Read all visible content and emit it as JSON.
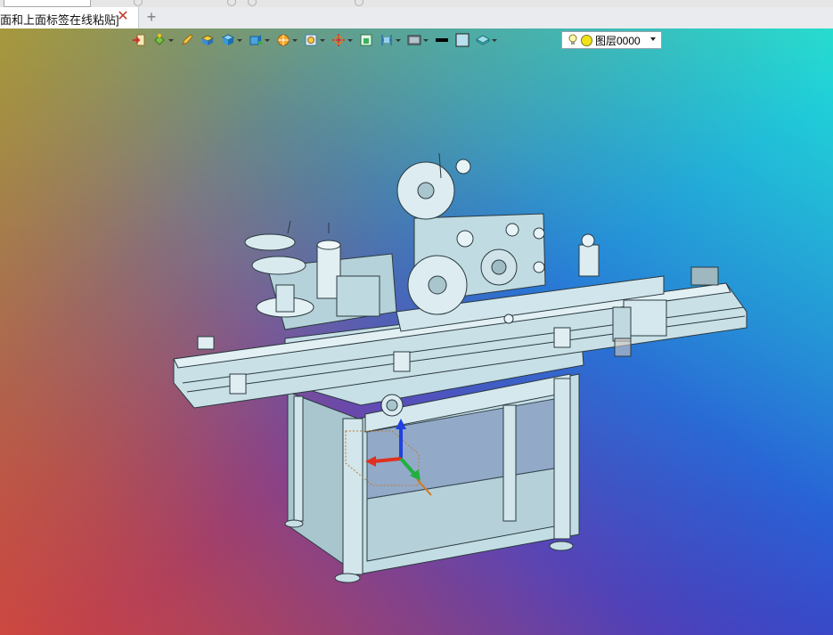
{
  "tabs": [
    {
      "label": "面和上面标签在线粘贴]",
      "close_glyph": "✕"
    }
  ],
  "new_tab_glyph": "+",
  "toolbar": {
    "buttons": [
      {
        "icon": "exit-sketch-icon",
        "dropdown": false
      },
      {
        "icon": "paint-bucket-icon",
        "dropdown": true
      },
      {
        "icon": "pencil-icon",
        "dropdown": false
      },
      {
        "icon": "box-face-icon",
        "dropdown": false
      },
      {
        "icon": "solid-cube-icon",
        "dropdown": true
      },
      {
        "icon": "view-cube-icon",
        "dropdown": true
      },
      {
        "icon": "render-sphere-icon",
        "dropdown": true
      },
      {
        "icon": "zoom-frame-icon",
        "dropdown": true
      },
      {
        "icon": "orbit-axes-icon",
        "dropdown": true
      },
      {
        "icon": "section-view-icon",
        "dropdown": false
      },
      {
        "icon": "measure-icon",
        "dropdown": true
      },
      {
        "icon": "display-mode-icon",
        "dropdown": true
      },
      {
        "icon": "line-style-icon",
        "dropdown": false
      },
      {
        "icon": "fill-color-icon",
        "dropdown": false
      },
      {
        "icon": "layer-plane-icon",
        "dropdown": true
      }
    ],
    "layer_select": {
      "value": "图层0000"
    }
  },
  "colors": {
    "tab_bg": "#ffffff",
    "tabbar_bg": "#e9ebee",
    "close_red": "#c0392b",
    "model_fill": "#b8d4dc",
    "model_stroke": "#2b3a40",
    "axis_x": "#e03020",
    "axis_y": "#20b040",
    "axis_z": "#2040e0"
  }
}
